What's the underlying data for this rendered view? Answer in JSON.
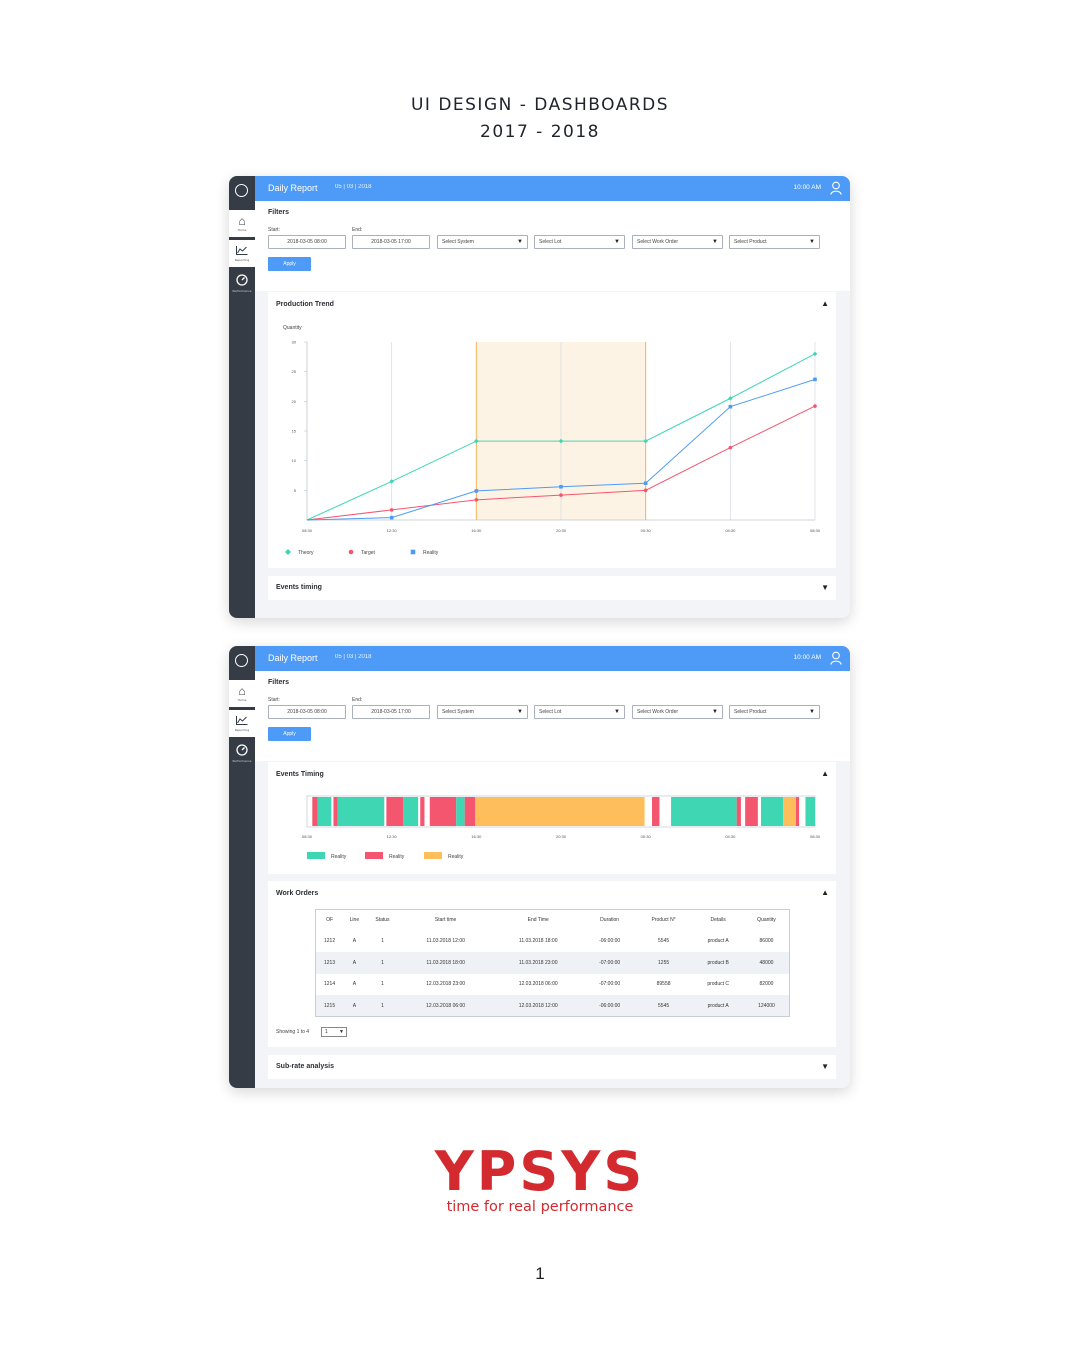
{
  "page": {
    "title_line1": "UI DESIGN - DASHBOARDS",
    "title_line2": "2017 - 2018",
    "page_number": "1"
  },
  "brand": {
    "logo_text": "YPSYS",
    "tagline": "time for real performance",
    "color": "#d32a2f"
  },
  "app": {
    "title": "Daily Report",
    "date": "05 | 03 | 2018",
    "time": "10:00 AM",
    "accent": "#4d9bf7",
    "sidebar_color": "#363c45",
    "sidebar": [
      {
        "label": "Home",
        "icon": "home-icon"
      },
      {
        "label": "Reporting",
        "icon": "chart-line-icon"
      },
      {
        "label": "Performance",
        "icon": "gauge-icon"
      }
    ]
  },
  "filters": {
    "title": "Filters",
    "start_label": "Start:",
    "end_label": "End:",
    "start_value": "2018-03-05    08:00",
    "end_value": "2018-03-05    17:00",
    "selects": [
      "Select System",
      "Select Lot",
      "Select Work Order",
      "Select Product"
    ],
    "apply_label": "Apply"
  },
  "cards": {
    "production_trend": "Production Trend",
    "events_timing_collapsed": "Events timing",
    "events_timing": "Events Timing",
    "work_orders": "Work Orders",
    "subrate": "Sub-rate analysis"
  },
  "chart_data": [
    {
      "type": "line",
      "title": "Production Trend",
      "ylabel": "Quantity",
      "x": [
        "08:30",
        "12:30",
        "16:30",
        "20:30",
        "00:30",
        "04:30",
        "08:30"
      ],
      "yticks": [
        5,
        10,
        15,
        20,
        25,
        30
      ],
      "ylim": [
        0,
        30
      ],
      "grid": "vertical",
      "highlight_range": [
        "16:30",
        "00:30"
      ],
      "highlight_color": "#fdf3e4",
      "series": [
        {
          "name": "Theory",
          "color": "#3fd6b4",
          "marker": "diamond",
          "values": [
            0,
            6.5,
            13.3,
            13.3,
            13.3,
            20.5,
            28
          ]
        },
        {
          "name": "Target",
          "color": "#f5566f",
          "marker": "circle",
          "values": [
            0,
            1.7,
            3.4,
            4.2,
            5,
            12.2,
            19.2
          ]
        },
        {
          "name": "Reality",
          "color": "#4d9bf7",
          "marker": "square",
          "values": [
            0,
            0.4,
            4.9,
            5.6,
            6.2,
            19.1,
            23.7
          ]
        }
      ],
      "legend": "bottom-left"
    },
    {
      "type": "timeline",
      "title": "Events Timing",
      "x": [
        "08:30",
        "12:30",
        "16:30",
        "20:30",
        "00:30",
        "04:30",
        "08:30"
      ],
      "x_start_hours": 0,
      "x_end_hours": 24,
      "legend": [
        {
          "name": "Reality",
          "color": "#3fd6b4"
        },
        {
          "name": "Reality",
          "color": "#f5566f"
        },
        {
          "name": "Reality",
          "color": "#ffbe5c"
        }
      ],
      "segments": [
        {
          "start": 0.0,
          "end": 0.25,
          "color": "white"
        },
        {
          "start": 0.25,
          "end": 0.5,
          "color": "red"
        },
        {
          "start": 0.5,
          "end": 1.15,
          "color": "green"
        },
        {
          "start": 1.15,
          "end": 1.25,
          "color": "white"
        },
        {
          "start": 1.25,
          "end": 1.45,
          "color": "red"
        },
        {
          "start": 1.45,
          "end": 3.65,
          "color": "green"
        },
        {
          "start": 3.65,
          "end": 3.75,
          "color": "white"
        },
        {
          "start": 3.75,
          "end": 4.55,
          "color": "red"
        },
        {
          "start": 4.55,
          "end": 5.25,
          "color": "green"
        },
        {
          "start": 5.25,
          "end": 5.35,
          "color": "white"
        },
        {
          "start": 5.35,
          "end": 5.55,
          "color": "red"
        },
        {
          "start": 5.55,
          "end": 5.8,
          "color": "white"
        },
        {
          "start": 5.8,
          "end": 7.05,
          "color": "red"
        },
        {
          "start": 7.05,
          "end": 7.45,
          "color": "green"
        },
        {
          "start": 7.45,
          "end": 7.95,
          "color": "red"
        },
        {
          "start": 7.95,
          "end": 15.95,
          "color": "orange"
        },
        {
          "start": 15.95,
          "end": 16.3,
          "color": "white"
        },
        {
          "start": 16.3,
          "end": 16.65,
          "color": "red"
        },
        {
          "start": 16.65,
          "end": 17.2,
          "color": "white"
        },
        {
          "start": 17.2,
          "end": 20.3,
          "color": "green"
        },
        {
          "start": 20.3,
          "end": 20.5,
          "color": "red"
        },
        {
          "start": 20.5,
          "end": 20.7,
          "color": "white"
        },
        {
          "start": 20.7,
          "end": 21.3,
          "color": "red"
        },
        {
          "start": 21.3,
          "end": 21.45,
          "color": "white"
        },
        {
          "start": 21.45,
          "end": 22.5,
          "color": "green"
        },
        {
          "start": 22.5,
          "end": 23.1,
          "color": "orange"
        },
        {
          "start": 23.1,
          "end": 23.25,
          "color": "red"
        },
        {
          "start": 23.25,
          "end": 23.55,
          "color": "white"
        },
        {
          "start": 23.55,
          "end": 24.0,
          "color": "green"
        }
      ]
    }
  ],
  "work_orders": {
    "columns": [
      "OF",
      "Line",
      "Status",
      "Start time",
      "End Time",
      "Duration",
      "Product N°",
      "Details",
      "Quantity"
    ],
    "rows": [
      [
        "1212",
        "A",
        "1",
        "11.03.2018  12:00",
        "11.03.2018  18:00",
        "-06:00:00",
        "5545",
        "product A",
        "86000"
      ],
      [
        "1213",
        "A",
        "1",
        "11.03.2018  18:00",
        "11.03.2018  23:00",
        "-07:00:00",
        "1255",
        "product B",
        "48000"
      ],
      [
        "1214",
        "A",
        "1",
        "12.03.2018  23:00",
        "12.03.2018  06:00",
        "-07:00:00",
        "89558",
        "product C",
        "82000"
      ],
      [
        "1215",
        "A",
        "1",
        "12.03.2018  06:00",
        "12.03.2018  12:00",
        "-06:00:00",
        "5545",
        "product A",
        "124000"
      ]
    ],
    "showing_text": "Showing 1 to 4",
    "page_value": "1"
  }
}
